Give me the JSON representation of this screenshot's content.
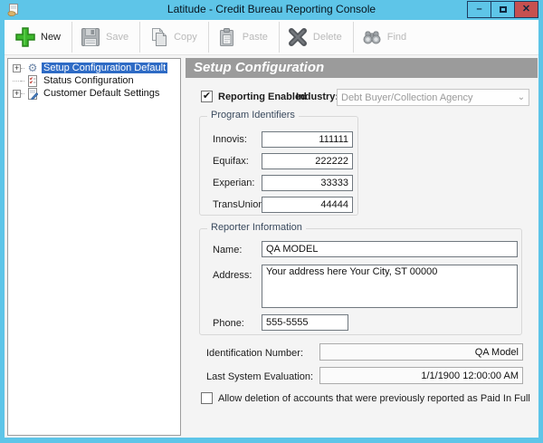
{
  "window": {
    "title": "Latitude - Credit Bureau Reporting Console"
  },
  "toolbar": {
    "buttons": [
      {
        "label": "New",
        "enabled": true
      },
      {
        "label": "Save",
        "enabled": false
      },
      {
        "label": "Copy",
        "enabled": false
      },
      {
        "label": "Paste",
        "enabled": false
      },
      {
        "label": "Delete",
        "enabled": false
      },
      {
        "label": "Find",
        "enabled": false
      }
    ]
  },
  "tree": {
    "items": [
      {
        "label": "Setup Configuration Default",
        "selected": true,
        "expandable": true
      },
      {
        "label": "Status Configuration",
        "selected": false,
        "expandable": false
      },
      {
        "label": "Customer Default Settings",
        "selected": false,
        "expandable": true
      }
    ]
  },
  "main": {
    "header": "Setup Configuration",
    "reporting_enabled": {
      "label": "Reporting Enabled",
      "checked": true
    },
    "industry": {
      "label": "Industry:",
      "value": "Debt Buyer/Collection Agency",
      "disabled": true
    },
    "program_identifiers": {
      "title": "Program Identifiers",
      "fields": [
        {
          "label": "Innovis:",
          "value": "111111"
        },
        {
          "label": "Equifax:",
          "value": "222222"
        },
        {
          "label": "Experian:",
          "value": "33333"
        },
        {
          "label": "TransUnion:",
          "value": "44444"
        }
      ]
    },
    "reporter_information": {
      "title": "Reporter Information",
      "name_label": "Name:",
      "name_value": "QA MODEL",
      "address_label": "Address:",
      "address_value": "Your address here Your City, ST 00000",
      "phone_label": "Phone:",
      "phone_value": "555-5555"
    },
    "identification_number": {
      "label": "Identification Number:",
      "value": "QA Model"
    },
    "last_system_evaluation": {
      "label": "Last System Evaluation:",
      "value": "1/1/1900 12:00:00 AM"
    },
    "allow_deletion": {
      "label": "Allow deletion of accounts that were previously reported as Paid In Full",
      "checked": false
    }
  },
  "icons": {
    "minimize": "–",
    "close": "✕",
    "check": "✔",
    "expand_plus": "+",
    "dropdown_chevron": "⌄",
    "gear": "⚙"
  },
  "colors": {
    "titlebar_blue": "#5EC5E8",
    "close_red": "#C75050",
    "panel_header_gray": "#9B9B9B",
    "tree_selection_blue": "#2E6BC5",
    "new_button_green": "#3CB72C"
  }
}
